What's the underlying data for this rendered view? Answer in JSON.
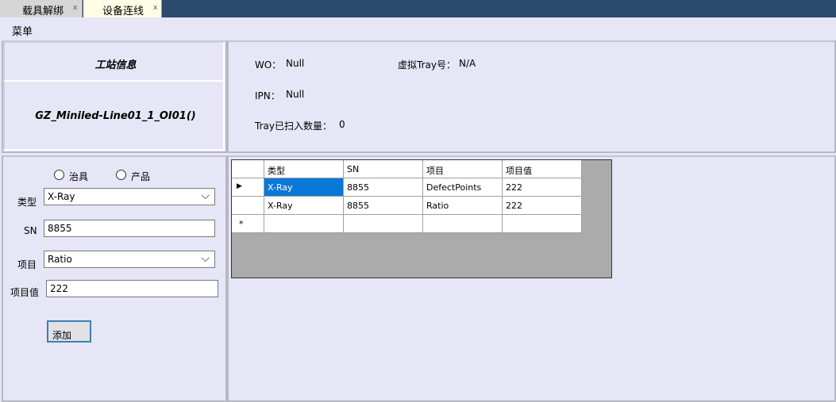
{
  "tabs": [
    {
      "label": "载具解绑",
      "close": "x"
    },
    {
      "label": "设备连线",
      "close": "x"
    }
  ],
  "menu": {
    "label": "菜单"
  },
  "station": {
    "title": "工站信息",
    "line": "GZ_Miniled-Line01_1_OI01()"
  },
  "info": {
    "wo_label": "WO：",
    "wo_value": "Null",
    "tray_label": "虚拟Tray号：",
    "tray_value": "N/A",
    "ipn_label": "IPN：",
    "ipn_value": "Null",
    "count_label": "Tray已扫入数量：",
    "count_value": "0"
  },
  "form": {
    "radio_fixture": "治具",
    "radio_product": "产品",
    "type_label": "类型",
    "type_value": "X-Ray",
    "sn_label": "SN",
    "sn_value": "8855",
    "item_label": "项目",
    "item_value": "Ratio",
    "itemval_label": "项目值",
    "itemval_value": "222",
    "add_button": "添加"
  },
  "grid": {
    "columns": [
      "类型",
      "SN",
      "项目",
      "项目值"
    ],
    "rows": [
      [
        "X-Ray",
        "8855",
        "DefectPoints",
        "222"
      ],
      [
        "X-Ray",
        "8855",
        "Ratio",
        "222"
      ]
    ],
    "current_marker": "▶",
    "new_marker": "*"
  }
}
